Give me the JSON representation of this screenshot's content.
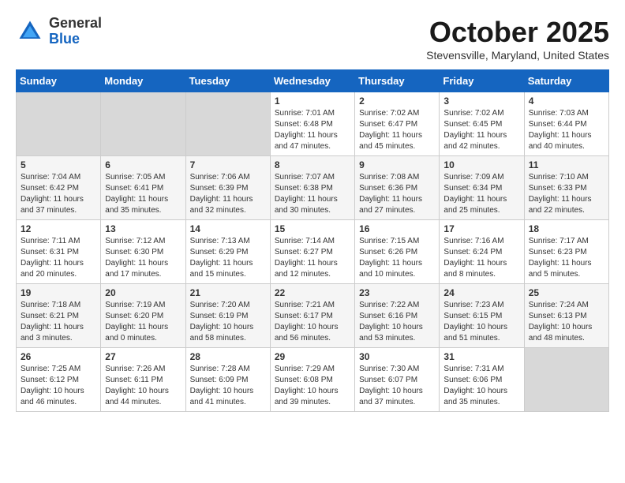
{
  "header": {
    "logo_general": "General",
    "logo_blue": "Blue",
    "month": "October 2025",
    "location": "Stevensville, Maryland, United States"
  },
  "weekdays": [
    "Sunday",
    "Monday",
    "Tuesday",
    "Wednesday",
    "Thursday",
    "Friday",
    "Saturday"
  ],
  "weeks": [
    {
      "days": [
        {
          "num": "",
          "info": ""
        },
        {
          "num": "",
          "info": ""
        },
        {
          "num": "",
          "info": ""
        },
        {
          "num": "1",
          "info": "Sunrise: 7:01 AM\nSunset: 6:48 PM\nDaylight: 11 hours\nand 47 minutes."
        },
        {
          "num": "2",
          "info": "Sunrise: 7:02 AM\nSunset: 6:47 PM\nDaylight: 11 hours\nand 45 minutes."
        },
        {
          "num": "3",
          "info": "Sunrise: 7:02 AM\nSunset: 6:45 PM\nDaylight: 11 hours\nand 42 minutes."
        },
        {
          "num": "4",
          "info": "Sunrise: 7:03 AM\nSunset: 6:44 PM\nDaylight: 11 hours\nand 40 minutes."
        }
      ]
    },
    {
      "days": [
        {
          "num": "5",
          "info": "Sunrise: 7:04 AM\nSunset: 6:42 PM\nDaylight: 11 hours\nand 37 minutes."
        },
        {
          "num": "6",
          "info": "Sunrise: 7:05 AM\nSunset: 6:41 PM\nDaylight: 11 hours\nand 35 minutes."
        },
        {
          "num": "7",
          "info": "Sunrise: 7:06 AM\nSunset: 6:39 PM\nDaylight: 11 hours\nand 32 minutes."
        },
        {
          "num": "8",
          "info": "Sunrise: 7:07 AM\nSunset: 6:38 PM\nDaylight: 11 hours\nand 30 minutes."
        },
        {
          "num": "9",
          "info": "Sunrise: 7:08 AM\nSunset: 6:36 PM\nDaylight: 11 hours\nand 27 minutes."
        },
        {
          "num": "10",
          "info": "Sunrise: 7:09 AM\nSunset: 6:34 PM\nDaylight: 11 hours\nand 25 minutes."
        },
        {
          "num": "11",
          "info": "Sunrise: 7:10 AM\nSunset: 6:33 PM\nDaylight: 11 hours\nand 22 minutes."
        }
      ]
    },
    {
      "days": [
        {
          "num": "12",
          "info": "Sunrise: 7:11 AM\nSunset: 6:31 PM\nDaylight: 11 hours\nand 20 minutes."
        },
        {
          "num": "13",
          "info": "Sunrise: 7:12 AM\nSunset: 6:30 PM\nDaylight: 11 hours\nand 17 minutes."
        },
        {
          "num": "14",
          "info": "Sunrise: 7:13 AM\nSunset: 6:29 PM\nDaylight: 11 hours\nand 15 minutes."
        },
        {
          "num": "15",
          "info": "Sunrise: 7:14 AM\nSunset: 6:27 PM\nDaylight: 11 hours\nand 12 minutes."
        },
        {
          "num": "16",
          "info": "Sunrise: 7:15 AM\nSunset: 6:26 PM\nDaylight: 11 hours\nand 10 minutes."
        },
        {
          "num": "17",
          "info": "Sunrise: 7:16 AM\nSunset: 6:24 PM\nDaylight: 11 hours\nand 8 minutes."
        },
        {
          "num": "18",
          "info": "Sunrise: 7:17 AM\nSunset: 6:23 PM\nDaylight: 11 hours\nand 5 minutes."
        }
      ]
    },
    {
      "days": [
        {
          "num": "19",
          "info": "Sunrise: 7:18 AM\nSunset: 6:21 PM\nDaylight: 11 hours\nand 3 minutes."
        },
        {
          "num": "20",
          "info": "Sunrise: 7:19 AM\nSunset: 6:20 PM\nDaylight: 11 hours\nand 0 minutes."
        },
        {
          "num": "21",
          "info": "Sunrise: 7:20 AM\nSunset: 6:19 PM\nDaylight: 10 hours\nand 58 minutes."
        },
        {
          "num": "22",
          "info": "Sunrise: 7:21 AM\nSunset: 6:17 PM\nDaylight: 10 hours\nand 56 minutes."
        },
        {
          "num": "23",
          "info": "Sunrise: 7:22 AM\nSunset: 6:16 PM\nDaylight: 10 hours\nand 53 minutes."
        },
        {
          "num": "24",
          "info": "Sunrise: 7:23 AM\nSunset: 6:15 PM\nDaylight: 10 hours\nand 51 minutes."
        },
        {
          "num": "25",
          "info": "Sunrise: 7:24 AM\nSunset: 6:13 PM\nDaylight: 10 hours\nand 48 minutes."
        }
      ]
    },
    {
      "days": [
        {
          "num": "26",
          "info": "Sunrise: 7:25 AM\nSunset: 6:12 PM\nDaylight: 10 hours\nand 46 minutes."
        },
        {
          "num": "27",
          "info": "Sunrise: 7:26 AM\nSunset: 6:11 PM\nDaylight: 10 hours\nand 44 minutes."
        },
        {
          "num": "28",
          "info": "Sunrise: 7:28 AM\nSunset: 6:09 PM\nDaylight: 10 hours\nand 41 minutes."
        },
        {
          "num": "29",
          "info": "Sunrise: 7:29 AM\nSunset: 6:08 PM\nDaylight: 10 hours\nand 39 minutes."
        },
        {
          "num": "30",
          "info": "Sunrise: 7:30 AM\nSunset: 6:07 PM\nDaylight: 10 hours\nand 37 minutes."
        },
        {
          "num": "31",
          "info": "Sunrise: 7:31 AM\nSunset: 6:06 PM\nDaylight: 10 hours\nand 35 minutes."
        },
        {
          "num": "",
          "info": ""
        }
      ]
    }
  ]
}
